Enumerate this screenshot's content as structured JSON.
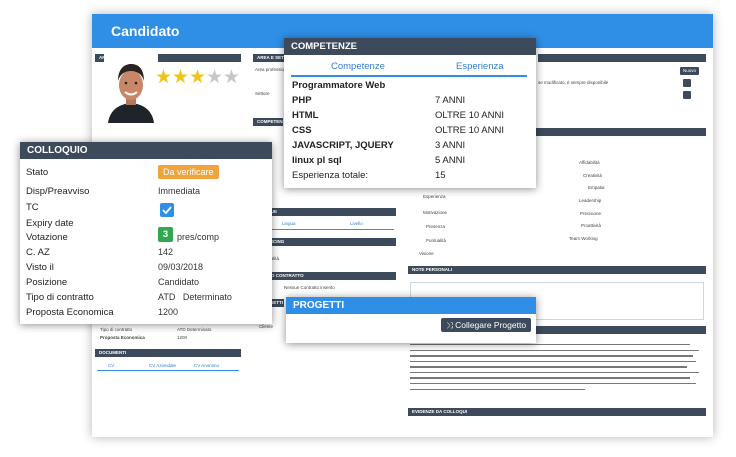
{
  "app": {
    "title": "Candidato"
  },
  "background": {
    "anagrafica_header": "ANAGRAFICA",
    "area_header": "AREA E SETTORE",
    "area_prof_label": "Area professionale",
    "settore_label": "Settore",
    "competenze_header": "COMPETENZE",
    "lingue_header": "LINGUE",
    "lingua_col": "Lingua",
    "livello_col": "Livello",
    "sourcing_header": "SOURCING",
    "sourcing_row": "Modalità",
    "stato_contratto_header": "STATO CONTRATTO",
    "nessun_contratto": "Nessun Contratto inserito",
    "progetti_header": "PROGETTI",
    "progetti_item": "Cliente",
    "tipo_contratto_label": "Tipo di contratto",
    "tipo_contratto_value": "ATD   Determinato",
    "proposta_label": "Proposta Economica",
    "proposta_value": "1200",
    "documenti_header": "DOCUMENTI",
    "doc_cols": [
      "CV",
      "CV Aziendale",
      "CV Anonimo"
    ],
    "nuovo_btn": "Nuovo",
    "note_header": "NOTE PERSONALI",
    "evidenze_header": "EVIDENZE DA COLLOQUI",
    "right_top_text_1": "se modificato, è sempre disponibile",
    "soft_left": [
      "Esperienza",
      "Motivazione",
      "Presenza",
      "Puntualità",
      "Visione"
    ],
    "soft_right": [
      "Affidabilità",
      "Creatività",
      "Empatia",
      "Leadership",
      "Precisione",
      "Proattività",
      "Team Working"
    ]
  },
  "colloquio": {
    "title": "COLLOQUIO",
    "rows": [
      {
        "label": "Stato",
        "value": "Da verificare"
      },
      {
        "label": "Disp/Preavviso",
        "value": "Immediata"
      },
      {
        "label": "TC",
        "value": ""
      },
      {
        "label": "Expiry date",
        "value": ""
      },
      {
        "label": "Votazione",
        "value": "pres/comp",
        "score": "3"
      },
      {
        "label": "C. AZ",
        "value": "142"
      },
      {
        "label": "Visto il",
        "value": "09/03/2018"
      },
      {
        "label": "Posizione",
        "value": "Candidato"
      },
      {
        "label": "Tipo di contratto",
        "value": "ATD   Determinato"
      },
      {
        "label": "Proposta Economica",
        "value": "1200"
      }
    ]
  },
  "competenze": {
    "title": "COMPETENZE",
    "tabs": [
      "Competenze",
      "Esperienza"
    ],
    "role": "Programmatore Web",
    "skills": [
      {
        "name": "PHP",
        "exp": "7 ANNI"
      },
      {
        "name": "HTML",
        "exp": "OLTRE 10 ANNI"
      },
      {
        "name": "CSS",
        "exp": "OLTRE 10 ANNI"
      },
      {
        "name": "JAVASCRIPT, JQUERY",
        "exp": "3 ANNI"
      },
      {
        "name": "linux pl sql",
        "exp": "5 ANNI"
      }
    ],
    "total_label": "Esperienza totale:",
    "total_value": "15"
  },
  "progetti": {
    "title": "PROGETTI",
    "button": "Collegare Progetto"
  },
  "rating": {
    "filled": 3,
    "total": 5
  },
  "colors": {
    "accent": "#2f8fe6",
    "header": "#3d4a5c",
    "star": "#f0c419",
    "orange": "#f0a33b",
    "green": "#2fa84f"
  },
  "icons": [
    "star-icon",
    "checkmark-icon",
    "link-icon",
    "edit-icon"
  ]
}
